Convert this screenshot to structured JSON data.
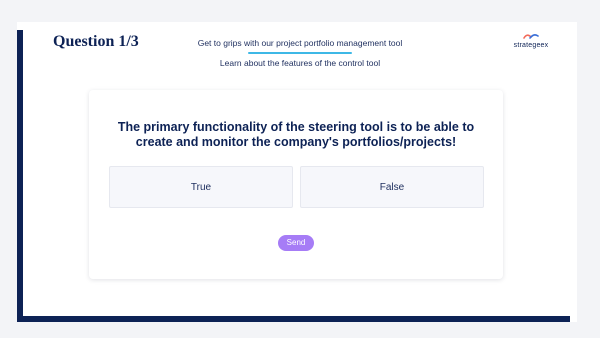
{
  "header": {
    "question_title": "Question 1/3",
    "nav_primary": "Get to grips with our project portfolio management tool",
    "nav_secondary": "Learn about the features of the control tool",
    "logo_text": "strategeex"
  },
  "quiz": {
    "question": "The primary functionality of the steering tool is to be able to create and monitor the company's portfolios/projects!",
    "answers": [
      {
        "label": "True"
      },
      {
        "label": "False"
      }
    ],
    "send_label": "Send"
  },
  "colors": {
    "navy": "#0d2255",
    "accent_underline": "#3db8e6",
    "send_button": "#a67cf6",
    "logo_mark_1": "#f26b5b",
    "logo_mark_2": "#3a6fd8"
  }
}
